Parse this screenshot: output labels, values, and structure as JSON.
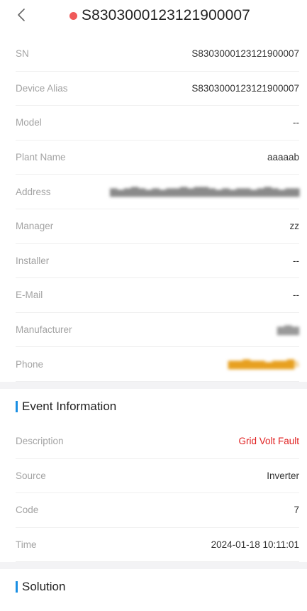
{
  "header": {
    "back_icon": "chevron-left-icon",
    "status_color": "#f05a5a",
    "title": "S8303000123121900007"
  },
  "device": [
    {
      "label": "SN",
      "value": "S8303000123121900007"
    },
    {
      "label": "Device Alias",
      "value": "S8303000123121900007"
    },
    {
      "label": "Model",
      "value": "--"
    },
    {
      "label": "Plant Name",
      "value": "aaaaab"
    },
    {
      "label": "Address",
      "value": "▆▅▆▇▆▅▆▅▆▆▇▆▇▇▆▅▆▅▆▆▅▆▇▆▅▆▆"
    },
    {
      "label": "Manager",
      "value": "zz"
    },
    {
      "label": "Installer",
      "value": "--"
    },
    {
      "label": "E-Mail",
      "value": "--"
    },
    {
      "label": "Manufacturer",
      "value": "▆▇▆"
    },
    {
      "label": "Phone",
      "value": "▆▆▇▆▆▅▆▆▇s"
    }
  ],
  "event_section": {
    "title": "Event Information"
  },
  "event": [
    {
      "label": "Description",
      "value": "Grid Volt Fault",
      "color": "#e02020"
    },
    {
      "label": "Source",
      "value": "Inverter"
    },
    {
      "label": "Code",
      "value": "7"
    },
    {
      "label": "Time",
      "value": "2024-01-18 10:11:01"
    }
  ],
  "solution_section": {
    "title": "Solution"
  },
  "accent_color": "#1a8fe3"
}
